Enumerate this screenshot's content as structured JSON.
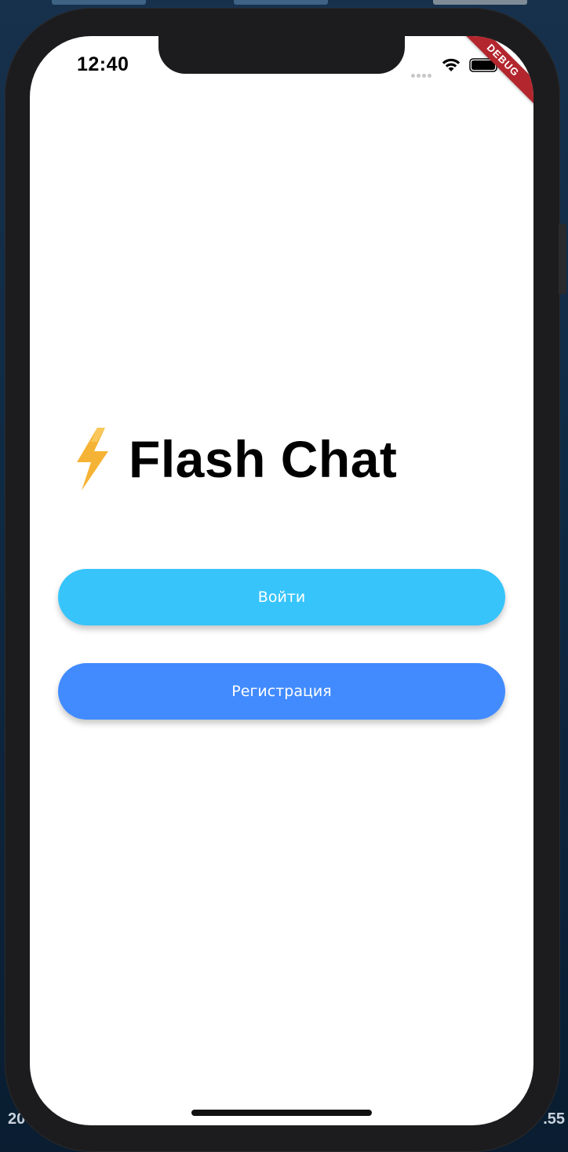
{
  "status_bar": {
    "time": "12:40",
    "debug_banner": "DEBUG"
  },
  "welcome": {
    "app_title": "Flash Chat",
    "logo_icon": "lightning-bolt-icon"
  },
  "buttons": {
    "login_label": "Войти",
    "register_label": "Регистрация"
  },
  "colors": {
    "login_button": "#37c4fb",
    "register_button": "#428bff",
    "bolt": "#f5b335"
  },
  "desktop_background": {
    "left_text": "20",
    "right_text": ".55"
  }
}
